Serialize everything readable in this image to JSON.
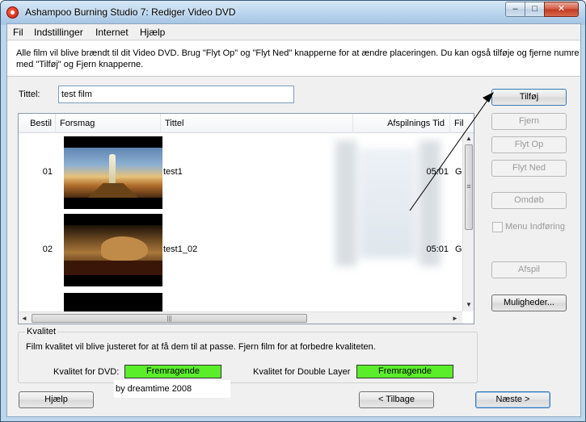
{
  "window": {
    "title": "Ashampoo Burning Studio 7: Rediger Video DVD",
    "controls": {
      "minimize": "–",
      "maximize": "□",
      "close": "✕"
    }
  },
  "menu": [
    "Fil",
    "Indstillinger",
    "Internet",
    "Hjælp"
  ],
  "intro": {
    "line1": "Alle film vil blive brændt til dit Video DVD. Brug \"Flyt Op\" og \"Flyt Ned\" knapperne for at ændre placeringen. Du kan også tilføje og fjerne numre",
    "line2": "med \"Tilføj\" og Fjern knapperne."
  },
  "title_field": {
    "label": "Tittel:",
    "value": "test film"
  },
  "list": {
    "columns": [
      "Bestil",
      "Forsmag",
      "Tittel",
      "Afspilnings Tid",
      "Fil"
    ],
    "rows": [
      {
        "order": "01",
        "title": "test1",
        "duration": "05:01",
        "file": "G:\\"
      },
      {
        "order": "02",
        "title": "test1_02",
        "duration": "05:01",
        "file": "G:\\"
      }
    ]
  },
  "buttons": {
    "add": "Tilføj",
    "remove": "Fjern",
    "move_up": "Flyt Op",
    "move_down": "Flyt Ned",
    "rename": "Omdøb",
    "menu_entry": "Menu Indføring",
    "play": "Afspil",
    "options": "Muligheder...",
    "help": "Hjælp",
    "back": "< Tilbage",
    "next": "Næste >"
  },
  "quality": {
    "legend": "Kvalitet",
    "description": "Film kvalitet vil blive justeret for at få dem til at passe. Fjern film for at forbedre kvaliteten.",
    "dvd_label": "Kvalitet for DVD:",
    "dvd_value": "Fremragende",
    "dl_label": "Kvalitet for Double Layer",
    "dl_value": "Fremragende",
    "bar_color": "#5aee2a"
  },
  "credit": "by dreamtime 2008",
  "scroll": {
    "up": "▲",
    "down": "▼",
    "left": "◄",
    "right": "►",
    "grip": "|||"
  }
}
